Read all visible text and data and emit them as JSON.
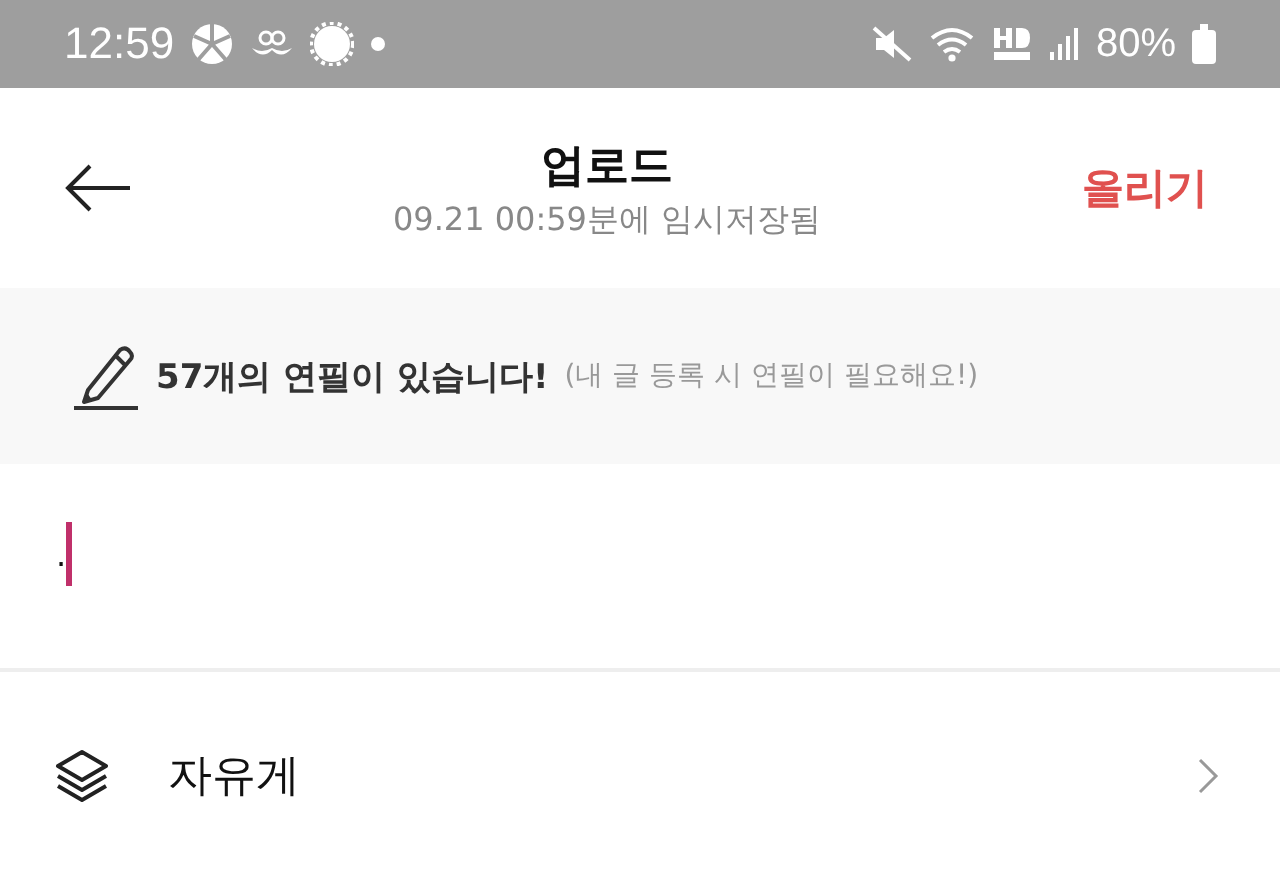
{
  "status_bar": {
    "time": "12:59",
    "battery": "80%"
  },
  "header": {
    "title": "업로드",
    "subtitle": "09.21 00:59분에 임시저장됨",
    "action": "올리기"
  },
  "notice": {
    "message": "57개의 연필이 있습니다!",
    "hint": "(내 글 등록 시 연필이 필요해요!)"
  },
  "editor": {
    "value": ".",
    "focused": true
  },
  "menu": [
    {
      "label": "자유게"
    }
  ]
}
